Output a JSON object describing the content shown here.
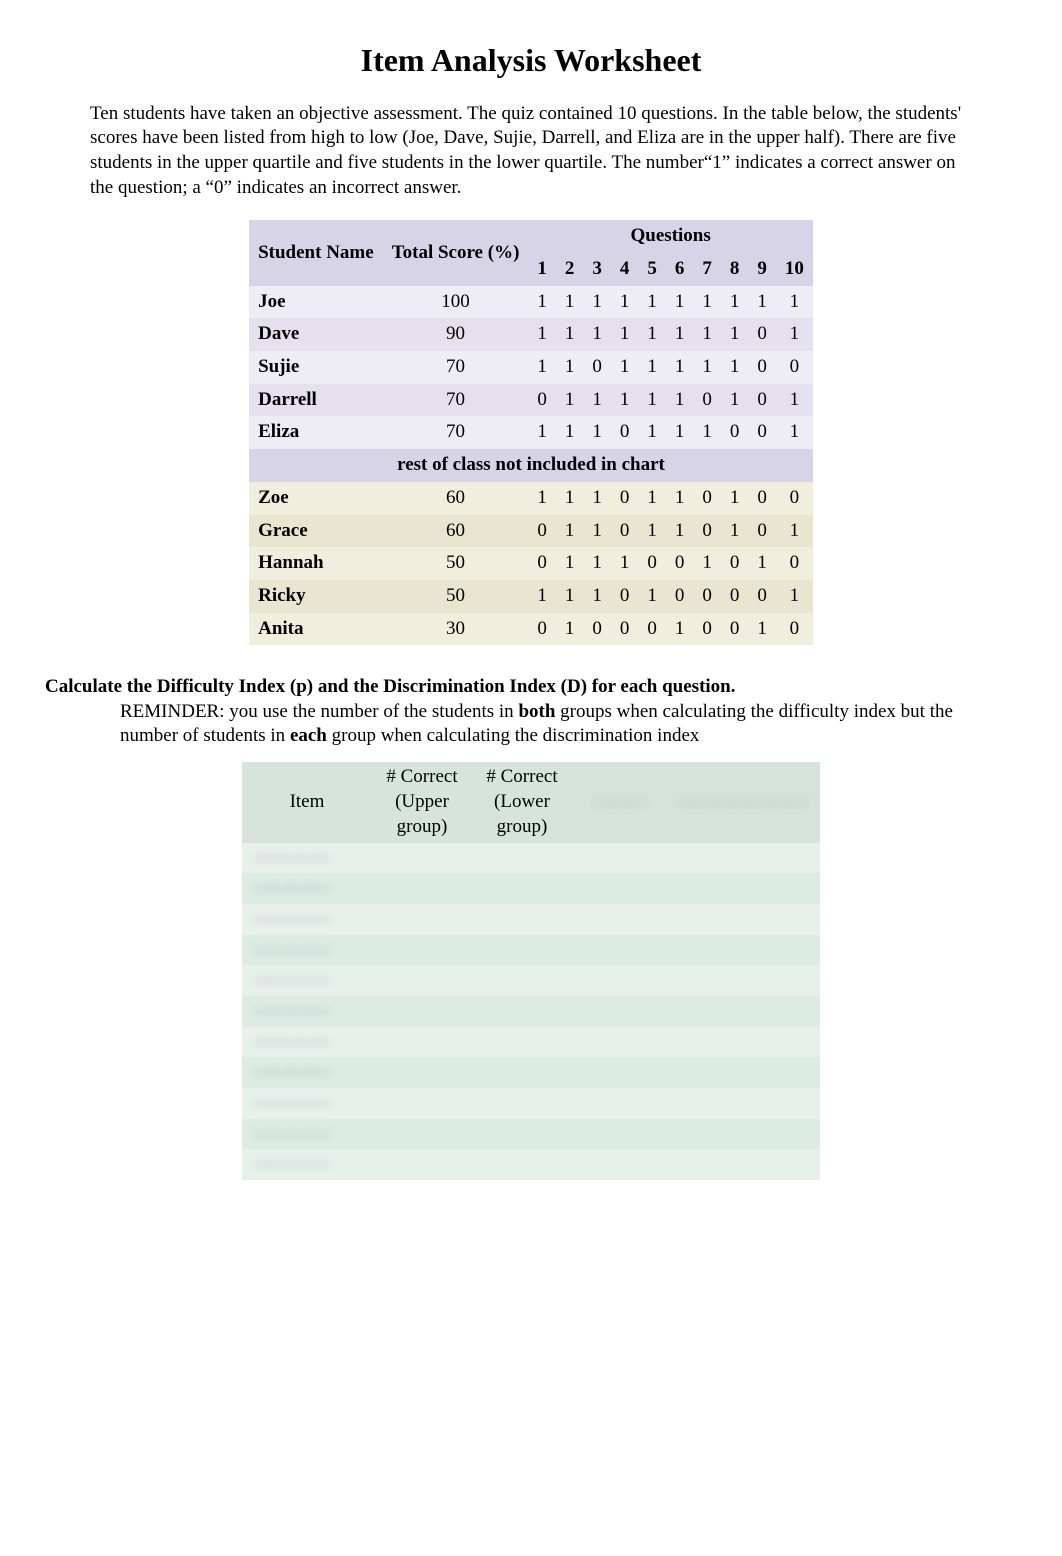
{
  "title": "Item Analysis Worksheet",
  "intro": "Ten students have taken an objective assessment.  The quiz contained 10 questions. In the table below, the students' scores have been listed from high to low (Joe, Dave, Sujie, Darrell, and Eliza are in the upper half). There are five students in the upper quartile and five students in the lower quartile. The number“1” indicates a correct answer on the question; a “0” indicates an incorrect answer.",
  "scores_table": {
    "header_name": "Student Name",
    "header_score": "Total Score (%)",
    "header_questions": "Questions",
    "q_cols": [
      "1",
      "2",
      "3",
      "4",
      "5",
      "6",
      "7",
      "8",
      "9",
      "10"
    ],
    "upper": [
      {
        "name": "Joe",
        "score": "100",
        "a": [
          "1",
          "1",
          "1",
          "1",
          "1",
          "1",
          "1",
          "1",
          "1",
          "1"
        ]
      },
      {
        "name": "Dave",
        "score": "90",
        "a": [
          "1",
          "1",
          "1",
          "1",
          "1",
          "1",
          "1",
          "1",
          "0",
          "1"
        ]
      },
      {
        "name": "Sujie",
        "score": "70",
        "a": [
          "1",
          "1",
          "0",
          "1",
          "1",
          "1",
          "1",
          "1",
          "0",
          "0"
        ]
      },
      {
        "name": "Darrell",
        "score": "70",
        "a": [
          "0",
          "1",
          "1",
          "1",
          "1",
          "1",
          "0",
          "1",
          "0",
          "1"
        ]
      },
      {
        "name": "Eliza",
        "score": "70",
        "a": [
          "1",
          "1",
          "1",
          "0",
          "1",
          "1",
          "1",
          "0",
          "0",
          "1"
        ]
      }
    ],
    "divider_text": "rest of class not included in chart",
    "lower": [
      {
        "name": "Zoe",
        "score": "60",
        "a": [
          "1",
          "1",
          "1",
          "0",
          "1",
          "1",
          "0",
          "1",
          "0",
          "0"
        ]
      },
      {
        "name": "Grace",
        "score": "60",
        "a": [
          "0",
          "1",
          "1",
          "0",
          "1",
          "1",
          "0",
          "1",
          "0",
          "1"
        ]
      },
      {
        "name": "Hannah",
        "score": "50",
        "a": [
          "0",
          "1",
          "1",
          "1",
          "0",
          "0",
          "1",
          "0",
          "1",
          "0"
        ]
      },
      {
        "name": "Ricky",
        "score": "50",
        "a": [
          "1",
          "1",
          "1",
          "0",
          "1",
          "0",
          "0",
          "0",
          "0",
          "1"
        ]
      },
      {
        "name": "Anita",
        "score": "30",
        "a": [
          "0",
          "1",
          "0",
          "0",
          "0",
          "1",
          "0",
          "0",
          "1",
          "0"
        ]
      }
    ]
  },
  "calc_heading": "Calculate the Difficulty Index (p) and the Discrimination Index (D) for each question.",
  "reminder_prefix": "REMINDER:  you use the number of the students in ",
  "reminder_bold1": "both",
  "reminder_mid": " groups when calculating the difficulty index but the number of students in ",
  "reminder_bold2": "each",
  "reminder_suffix": " group when calculating the discrimination index",
  "idx_table": {
    "h_item": "Item",
    "h_upper": "# Correct (Upper group)",
    "h_lower": "# Correct (Lower group)",
    "h_diff": "———",
    "h_disc": "———————",
    "rows": 11
  }
}
